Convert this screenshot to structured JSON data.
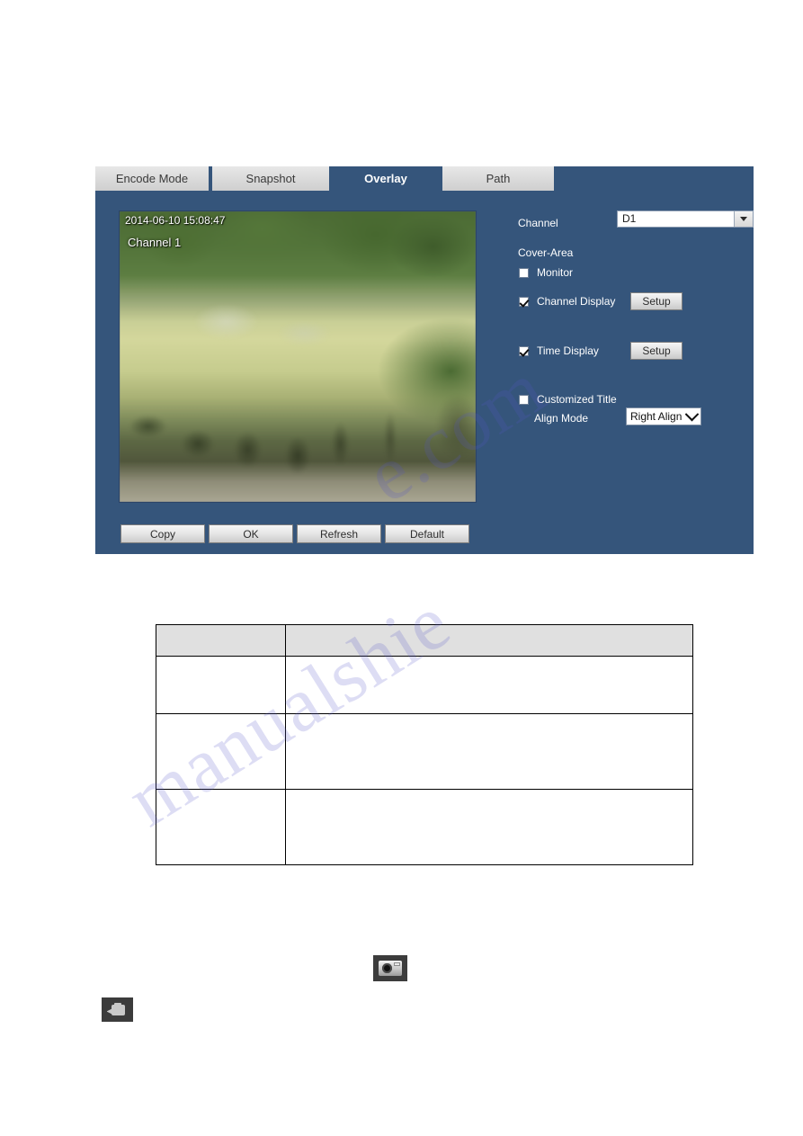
{
  "panel": {
    "tabs": [
      {
        "label": "Encode Mode",
        "active": false
      },
      {
        "label": "Snapshot",
        "active": false
      },
      {
        "label": "Overlay",
        "active": true
      },
      {
        "label": "Path",
        "active": false
      }
    ],
    "video_preview": {
      "timestamp_osd": "2014-06-10 15:08:47",
      "channel_osd": "Channel 1"
    },
    "form": {
      "channel_label": "Channel",
      "channel_value": "D1",
      "cover_area_label": "Cover-Area",
      "monitor_label": "Monitor",
      "monitor_checked": false,
      "channel_display_label": "Channel Display",
      "channel_display_checked": true,
      "channel_display_setup_label": "Setup",
      "time_display_label": "Time Display",
      "time_display_checked": true,
      "time_display_setup_label": "Setup",
      "customized_title_label": "Customized Title",
      "customized_title_checked": false,
      "align_mode_label": "Align Mode",
      "align_mode_value": "Right Align"
    },
    "actions": [
      {
        "label": "Copy"
      },
      {
        "label": "OK"
      },
      {
        "label": "Refresh"
      },
      {
        "label": "Default"
      }
    ]
  },
  "table": {
    "headers": [
      "",
      ""
    ],
    "rows": [
      [
        "",
        ""
      ],
      [
        "",
        ""
      ],
      [
        "",
        ""
      ]
    ]
  },
  "icons": {
    "snapshot_icon": "camera-icon",
    "record_icon": "video-camera-icon"
  },
  "watermark": {
    "line1": "manualshie",
    "line2": "e.com"
  },
  "colors": {
    "panel_bg": "#35557b",
    "tab_inactive_bg": "#dcdcdc",
    "tab_active_text": "#ffffff",
    "table_header_bg": "#e0e0e0",
    "icon_bg": "#3c3c3c"
  }
}
